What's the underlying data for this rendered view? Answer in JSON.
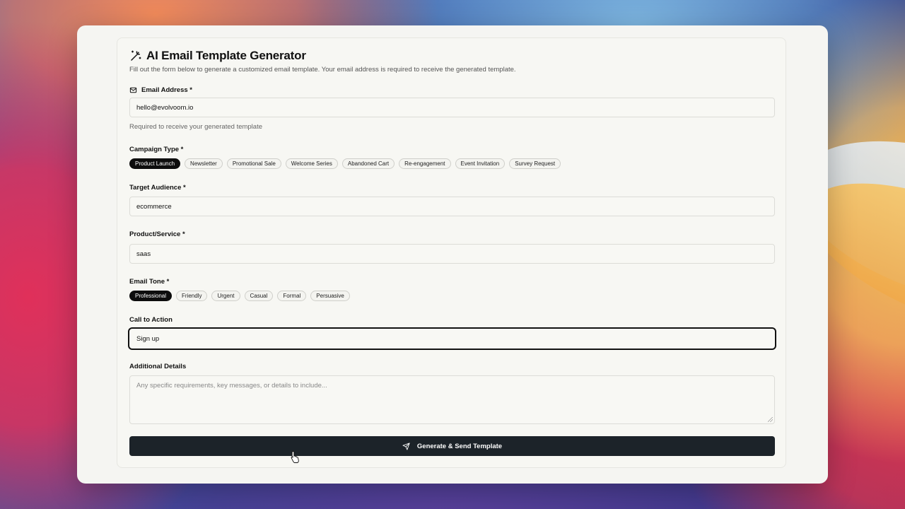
{
  "form": {
    "title": "AI Email Template Generator",
    "subtitle": "Fill out the form below to generate a customized email template. Your email address is required to receive the generated template.",
    "email": {
      "label": "Email Address *",
      "value": "hello@evolvoom.io",
      "hint": "Required to receive your generated template"
    },
    "campaign_type": {
      "label": "Campaign Type *",
      "options": [
        "Product Launch",
        "Newsletter",
        "Promotional Sale",
        "Welcome Series",
        "Abandoned Cart",
        "Re-engagement",
        "Event Invitation",
        "Survey Request"
      ],
      "selected": "Product Launch"
    },
    "target_audience": {
      "label": "Target Audience *",
      "value": "ecommerce"
    },
    "product_service": {
      "label": "Product/Service *",
      "value": "saas"
    },
    "email_tone": {
      "label": "Email Tone *",
      "options": [
        "Professional",
        "Friendly",
        "Urgent",
        "Casual",
        "Formal",
        "Persuasive"
      ],
      "selected": "Professional"
    },
    "call_to_action": {
      "label": "Call to Action",
      "value": "Sign up"
    },
    "additional_details": {
      "label": "Additional Details",
      "placeholder": "Any specific requirements, key messages, or details to include..."
    },
    "submit_label": "Generate & Send Template"
  },
  "colors": {
    "accent": "#0d0d0d",
    "button": "#1c2329",
    "card": "#f7f7f3"
  },
  "icons": {
    "title": "magic-wand-icon",
    "email": "mail-icon",
    "submit": "send-icon"
  }
}
